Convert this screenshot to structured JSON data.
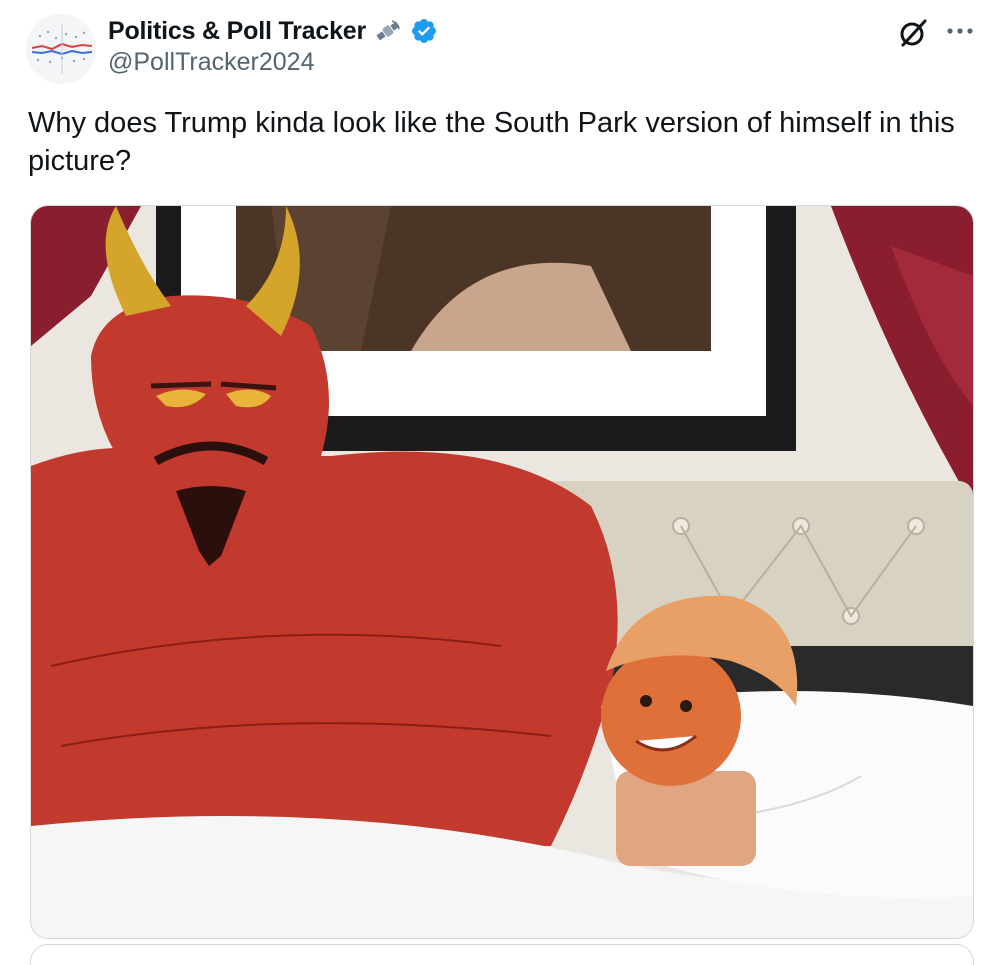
{
  "post": {
    "author": {
      "display_name": "Politics & Poll Tracker",
      "handle": "@PollTracker2024",
      "badge_icon": "satellite-icon",
      "verified_icon": "verified-badge-icon",
      "verified_color": "#1d9bf0"
    },
    "text": "Why does Trump kinda look like the South Park version of himself in this picture?",
    "actions": {
      "grok_icon": "grok-icon",
      "more_icon": "more-options-icon"
    }
  },
  "colors": {
    "text_primary": "#0f1419",
    "text_secondary": "#536471",
    "border": "#cfd9de"
  }
}
